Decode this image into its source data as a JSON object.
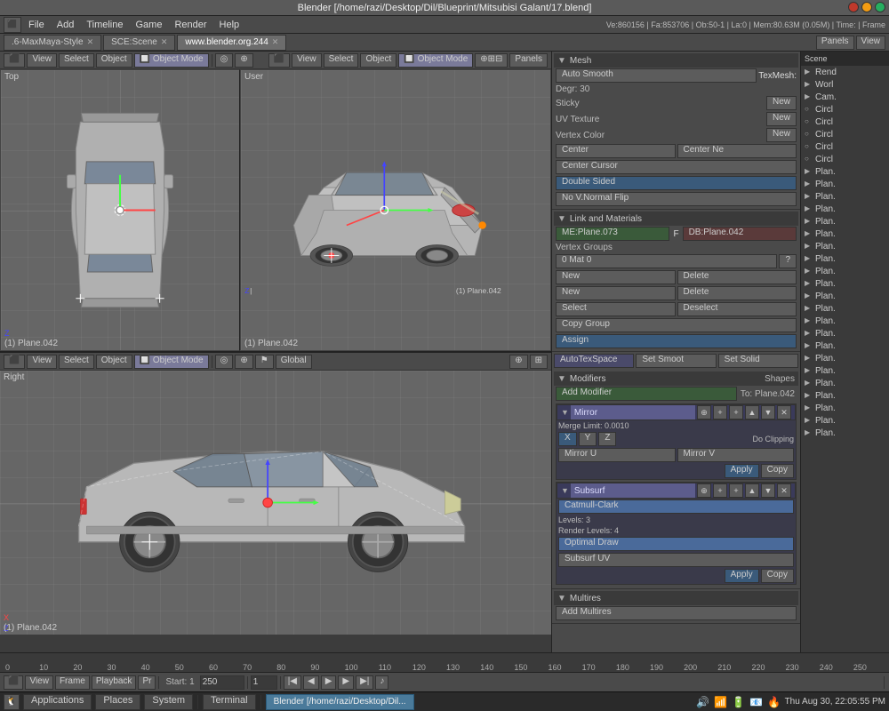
{
  "window": {
    "title": "Blender [/home/razi/Desktop/Dil/Blueprint/Mitsubisi Galant/17.blend]"
  },
  "menubar": {
    "icon": "⬛",
    "items": [
      "File",
      "Add",
      "Timeline",
      "Game",
      "Render",
      "Help"
    ],
    "style_tab": ".6-MaxMaya-Style",
    "scene_tab": "SCE:Scene",
    "url_tab": "www.blender.org.244",
    "stats": "Ve:860156 | Fa:853706 | Ob:50-1 | La:0 | Mem:80.63M (0.05M) | Time: | Frame"
  },
  "viewport_header_top": {
    "buttons": [
      "⬛",
      "View",
      "Select",
      "Object"
    ],
    "mode": "Object Mode",
    "panels_btn": "Panels",
    "view_btn": "View"
  },
  "viewport_top_left": {
    "label": "Top",
    "info": "(1) Plane.042"
  },
  "viewport_top_right": {
    "label": "User",
    "info": "(1) Plane.042"
  },
  "viewport_bottom": {
    "label": "Right",
    "info": "(1) Plane.042"
  },
  "right_panel": {
    "mesh_section": {
      "title": "Mesh",
      "auto_smooth_label": "Auto Smooth",
      "degr_label": "Degr: 30",
      "texmesh_label": "TexMesh:",
      "sticky_label": "Sticky",
      "new_btn": "New",
      "uv_texture_label": "UV Texture",
      "new2_btn": "New",
      "vertex_color_label": "Vertex Color",
      "new3_btn": "New",
      "center_btn": "Center",
      "center_new_btn": "Center Ne",
      "center_cursor_btn": "Center Cursor",
      "double_sided_btn": "Double Sided",
      "no_v_normal_flip_btn": "No V.Normal Flip"
    },
    "link_materials": {
      "title": "Link and Materials",
      "me_label": "ME:Plane.073",
      "f_label": "F",
      "db_label": "DB:Plane.042",
      "vertex_groups_label": "Vertex Groups",
      "mat_label": "0 Mat 0",
      "new_btn": "New",
      "delete_btn": "Delete",
      "new2_btn": "New",
      "delete2_btn": "Delete",
      "select_btn": "Select",
      "deselect_btn": "Deselect",
      "copy_group_btn": "Copy Group",
      "assign_btn": "Assign"
    },
    "autotex_btn": "AutoTexSpace",
    "set_smoot_btn": "Set Smoot",
    "set_solid_btn": "Set Solid",
    "modifiers": {
      "title": "Modifiers",
      "shapes_label": "Shapes",
      "add_modifier_btn": "Add Modifier",
      "to_label": "To: Plane.042",
      "mirror": {
        "name": "Mirror",
        "merge_label": "Merge Limit: 0.0010",
        "xyz_label": "X Y Z",
        "do_clipping_label": "Do Clipping",
        "mirror_u_label": "Mirror U",
        "mirror_v_label": "Mirror V",
        "apply_btn": "Apply",
        "copy_btn": "Copy"
      },
      "subsurf": {
        "name": "Subsurf",
        "catmull_clark_label": "Catmull-Clark",
        "levels_label": "Levels: 3",
        "render_levels_label": "Render Levels: 4",
        "optimal_draw_btn": "Optimal Draw",
        "subsurf_uv_btn": "Subsurf UV",
        "apply_btn": "Apply",
        "copy_btn": "Copy"
      }
    },
    "multires": {
      "title": "Multires",
      "add_multires_btn": "Add Multires"
    }
  },
  "outliner": {
    "items": [
      {
        "icon": "▶",
        "label": "Rend",
        "type": "camera"
      },
      {
        "icon": "▶",
        "label": "Worl",
        "type": "world"
      },
      {
        "icon": "▶",
        "label": "Cam.",
        "type": "camera"
      },
      {
        "icon": "○",
        "label": "Circl",
        "type": "mesh"
      },
      {
        "icon": "○",
        "label": "Circl",
        "type": "mesh"
      },
      {
        "icon": "○",
        "label": "Circl",
        "type": "mesh"
      },
      {
        "icon": "○",
        "label": "Circl",
        "type": "mesh"
      },
      {
        "icon": "○",
        "label": "Circl",
        "type": "mesh"
      },
      {
        "icon": "▶",
        "label": "Plan.",
        "type": "mesh"
      },
      {
        "icon": "▶",
        "label": "Plan.",
        "type": "mesh"
      },
      {
        "icon": "▶",
        "label": "Plan.",
        "type": "mesh"
      },
      {
        "icon": "▶",
        "label": "Plan.",
        "type": "mesh"
      },
      {
        "icon": "▶",
        "label": "Plan.",
        "type": "mesh"
      },
      {
        "icon": "▶",
        "label": "Plan.",
        "type": "mesh"
      },
      {
        "icon": "▶",
        "label": "Plan.",
        "type": "mesh"
      },
      {
        "icon": "▶",
        "label": "Plan.",
        "type": "mesh"
      },
      {
        "icon": "▶",
        "label": "Plan.",
        "type": "mesh"
      },
      {
        "icon": "▶",
        "label": "Plan.",
        "type": "mesh"
      },
      {
        "icon": "▶",
        "label": "Plan.",
        "type": "mesh"
      },
      {
        "icon": "▶",
        "label": "Plan.",
        "type": "mesh"
      },
      {
        "icon": "▶",
        "label": "Plan.",
        "type": "mesh"
      },
      {
        "icon": "▶",
        "label": "Plan.",
        "type": "mesh"
      },
      {
        "icon": "▶",
        "label": "Plan.",
        "type": "mesh"
      },
      {
        "icon": "▶",
        "label": "Plan.",
        "type": "mesh"
      },
      {
        "icon": "▶",
        "label": "Plan.",
        "type": "mesh"
      },
      {
        "icon": "▶",
        "label": "Plan.",
        "type": "mesh"
      },
      {
        "icon": "▶",
        "label": "Plan.",
        "type": "mesh"
      },
      {
        "icon": "▶",
        "label": "Plan.",
        "type": "mesh"
      },
      {
        "icon": "▶",
        "label": "Plan.",
        "type": "mesh"
      },
      {
        "icon": "▶",
        "label": "Plan.",
        "type": "mesh"
      }
    ]
  },
  "timeline": {
    "ruler_marks": [
      "0",
      "10",
      "20",
      "30",
      "40",
      "50",
      "60",
      "70",
      "80",
      "90",
      "100",
      "110",
      "120",
      "130",
      "140",
      "150",
      "160",
      "170",
      "180",
      "190",
      "200",
      "210",
      "220",
      "230",
      "240",
      "250"
    ],
    "controls": {
      "view_btn": "View",
      "frame_btn": "Frame",
      "playback_btn": "Playback",
      "pr_label": "Pr",
      "start_label": "Start: 1",
      "end_label": "End: 250",
      "current_frame": "1"
    }
  },
  "taskbar": {
    "applications_btn": "Applications",
    "places_btn": "Places",
    "system_btn": "System",
    "terminal_btn": "Terminal",
    "active_app": "Blender [/home/razi/Desktop/Dil...",
    "clock": "Thu Aug 30, 22:05:55 PM"
  }
}
